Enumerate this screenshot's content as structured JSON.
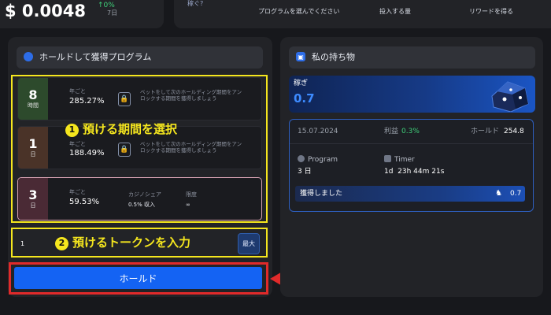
{
  "top": {
    "price": "$ 0.0048",
    "change": "↑0%",
    "change_period": "7日",
    "link_text": "稼ぐ?",
    "steps": [
      "プログラムを選んでください",
      "投入する量",
      "リワードを得る"
    ]
  },
  "left": {
    "header_title": "ホールドして獲得プログラム",
    "options": [
      {
        "num": "8",
        "unit": "時間",
        "label": "年ごと",
        "apy": "285.27%",
        "desc": "ベットをして次のホールディング期間をアンロックする期間を獲得しましょう",
        "tab_color": "#2d4a2c"
      },
      {
        "num": "1",
        "unit": "日",
        "label": "年ごと",
        "apy": "188.49%",
        "desc": "ベットをして次のホールディング期間をアンロックする期間を獲得しましょう",
        "tab_color": "#4a3328"
      },
      {
        "num": "3",
        "unit": "日",
        "label": "年ごと",
        "apy": "59.53%",
        "casino_label": "カジノシェア",
        "casino_value": "0.5% 収入",
        "limit_label": "限度",
        "limit_value": "∞",
        "tab_color": "#4a2a35"
      }
    ],
    "annotation_1": "預ける期間を選択",
    "annotation_1_num": "1",
    "annotation_2": "預けるトークンを入力",
    "annotation_2_num": "2",
    "amount_value": "1",
    "max_label": "最大",
    "hold_label": "ホールド"
  },
  "right": {
    "header_title": "私の持ち物",
    "earned_label": "稼ぎ",
    "earned_value": "0.7",
    "card": {
      "date": "15.07.2024",
      "profit_label": "利益",
      "profit_value": "0.3%",
      "hold_label": "ホールド",
      "hold_value": "254.8",
      "program_label": "Program",
      "program_value": "3 日",
      "timer_label": "Timer",
      "timer_value": "1d  23h 44m 21s",
      "obtained_label": "獲得しました",
      "obtained_value": "0.7"
    }
  },
  "colors": {
    "annotation_yellow": "#f5e61e",
    "annotation_red": "#e02a2a",
    "hold_blue": "#1463f3",
    "profit_green": "#3fd17a"
  }
}
